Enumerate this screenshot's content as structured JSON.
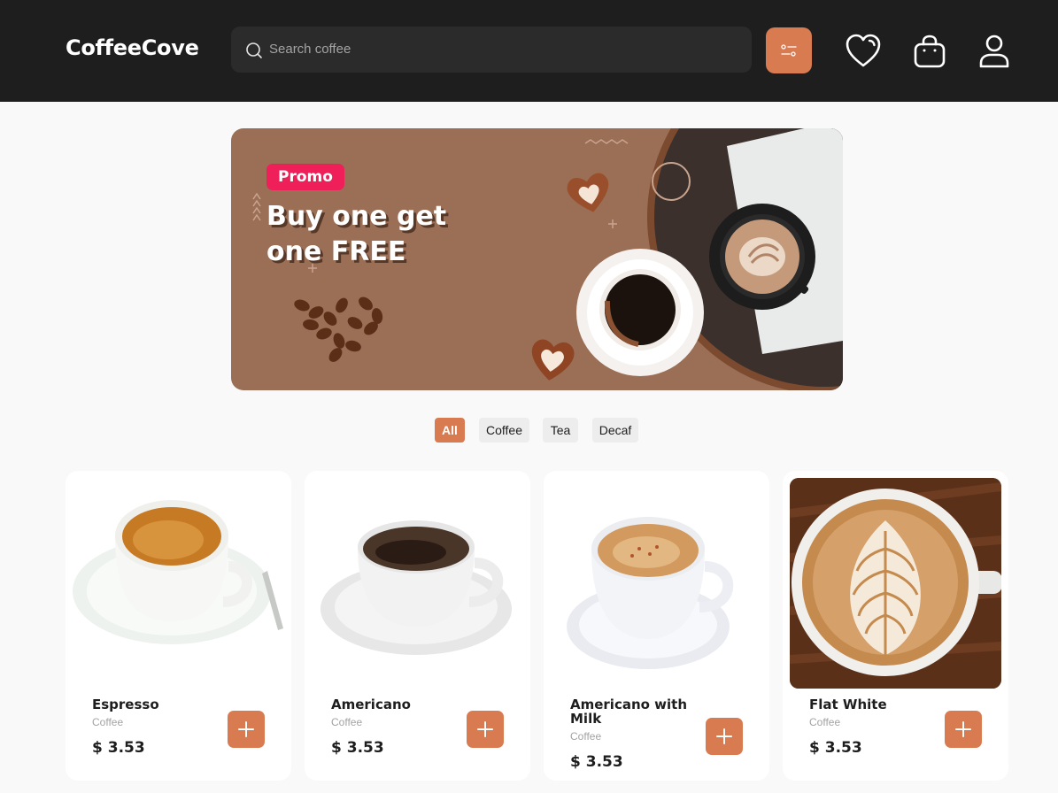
{
  "app": {
    "logo": "CoffeeCove"
  },
  "header": {
    "search_placeholder": "Search coffee",
    "icons": [
      "search-icon",
      "filter-icon",
      "heart-icon",
      "shopping-bag-icon",
      "user-icon"
    ]
  },
  "banner": {
    "badge": "Promo",
    "title": "Buy one get one FREE"
  },
  "categories": [
    {
      "label": "All",
      "active": true
    },
    {
      "label": "Coffee",
      "active": false
    },
    {
      "label": "Tea",
      "active": false
    },
    {
      "label": "Decaf",
      "active": false
    }
  ],
  "products": [
    {
      "name": "Espresso",
      "category": "Coffee",
      "price": "$ 3.53"
    },
    {
      "name": "Americano",
      "category": "Coffee",
      "price": "$ 3.53"
    },
    {
      "name": "Americano with Milk",
      "category": "Coffee",
      "price": "$ 3.53"
    },
    {
      "name": "Flat White",
      "category": "Coffee",
      "price": "$ 3.53"
    }
  ],
  "colors": {
    "header_bg": "#1e1e1e",
    "accent": "#d97b51",
    "promo_badge": "#ef1f5a",
    "banner_bg": "#9b6e56",
    "page_bg": "#f9f9f9"
  }
}
